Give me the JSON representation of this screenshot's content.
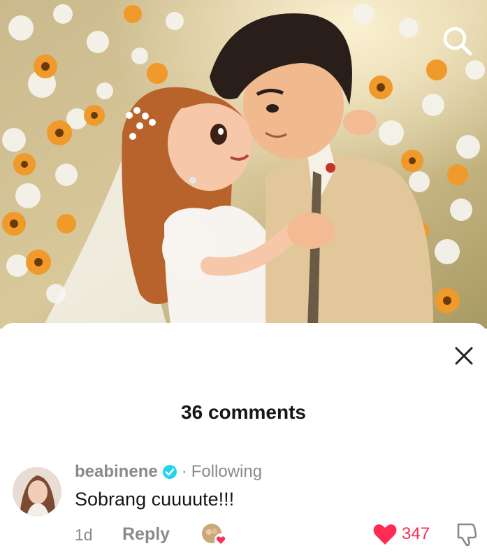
{
  "comments_sheet": {
    "count_label": "36 comments",
    "comment": {
      "username": "beabinene",
      "separator": "·",
      "follow_status": "Following",
      "text": "Sobrang cuuuute!!!",
      "time": "1d",
      "reply_label": "Reply",
      "like_count": "347"
    }
  },
  "colors": {
    "accent_like": "#fe2c55",
    "verified": "#20d5ec",
    "secondary_text": "#8a8a8a"
  },
  "icons": [
    "search-icon",
    "close-icon",
    "verified-badge-icon",
    "heart-icon",
    "dislike-icon"
  ]
}
